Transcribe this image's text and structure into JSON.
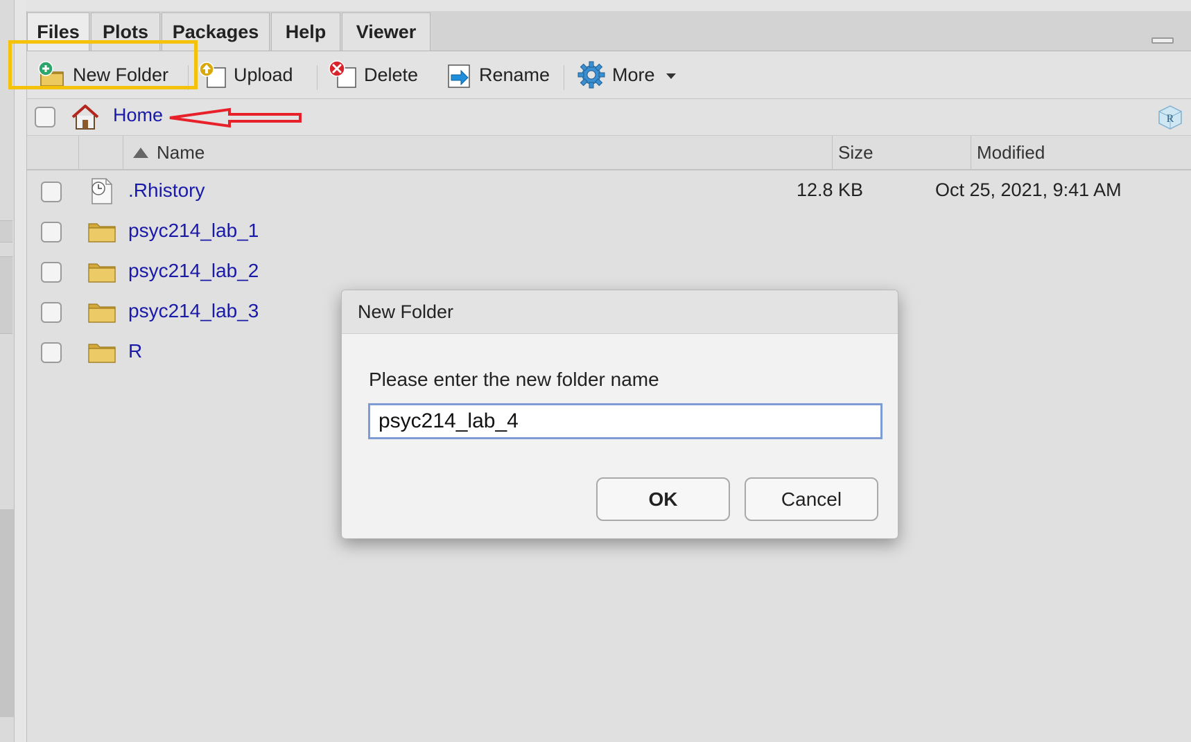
{
  "tabs": [
    {
      "label": "Files",
      "active": true
    },
    {
      "label": "Plots",
      "active": false
    },
    {
      "label": "Packages",
      "active": false
    },
    {
      "label": "Help",
      "active": false
    },
    {
      "label": "Viewer",
      "active": false
    }
  ],
  "toolbar": {
    "new_folder": "New Folder",
    "upload": "Upload",
    "delete": "Delete",
    "rename": "Rename",
    "more": "More"
  },
  "path": {
    "home_label": "Home"
  },
  "columns": {
    "name": "Name",
    "size": "Size",
    "modified": "Modified"
  },
  "files": [
    {
      "name": ".Rhistory",
      "type": "history-file",
      "size": "12.8 KB",
      "modified": "Oct 25, 2021, 9:41 AM"
    },
    {
      "name": "psyc214_lab_1",
      "type": "folder",
      "size": "",
      "modified": ""
    },
    {
      "name": "psyc214_lab_2",
      "type": "folder",
      "size": "",
      "modified": ""
    },
    {
      "name": "psyc214_lab_3",
      "type": "folder",
      "size": "",
      "modified": ""
    },
    {
      "name": "R",
      "type": "folder",
      "size": "",
      "modified": ""
    }
  ],
  "dialog": {
    "title": "New Folder",
    "prompt": "Please enter the new folder name",
    "input_value": "psyc214_lab_4",
    "ok_label": "OK",
    "cancel_label": "Cancel"
  },
  "colors": {
    "highlight_box": "#f5c20b",
    "annotation_arrow": "#e8202a",
    "link_blue": "#1a1aa8",
    "input_focus": "#7e9cd4"
  }
}
